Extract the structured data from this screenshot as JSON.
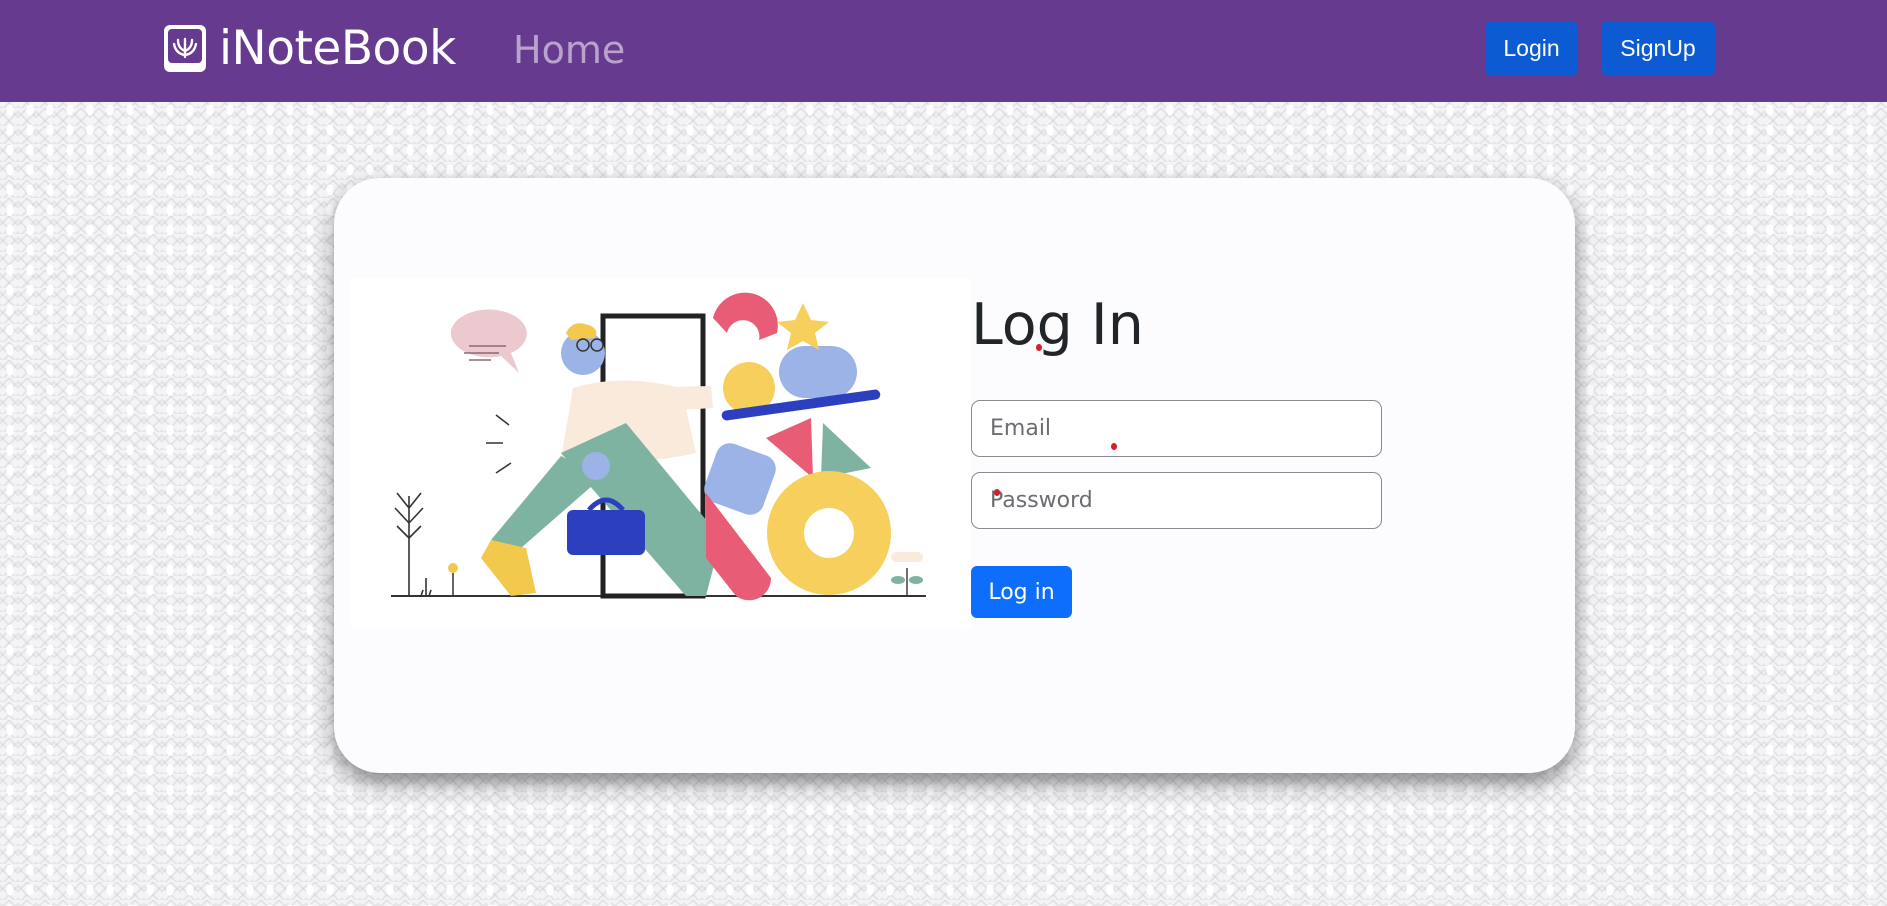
{
  "navbar": {
    "brand": "iNoteBook",
    "home_link": "Home",
    "login_button": "Login",
    "signup_button": "SignUp",
    "icons": [
      "notebook-logo-icon"
    ],
    "colors": {
      "navbar": "#663a8f",
      "button": "#0d5bd3"
    }
  },
  "login": {
    "title": "Log In",
    "email_placeholder": "Email",
    "password_placeholder": "Password",
    "submit_label": "Log in",
    "colors": {
      "submit": "#0d6efd"
    }
  },
  "illustration": {
    "icon": "person-entering-door-illustration"
  }
}
